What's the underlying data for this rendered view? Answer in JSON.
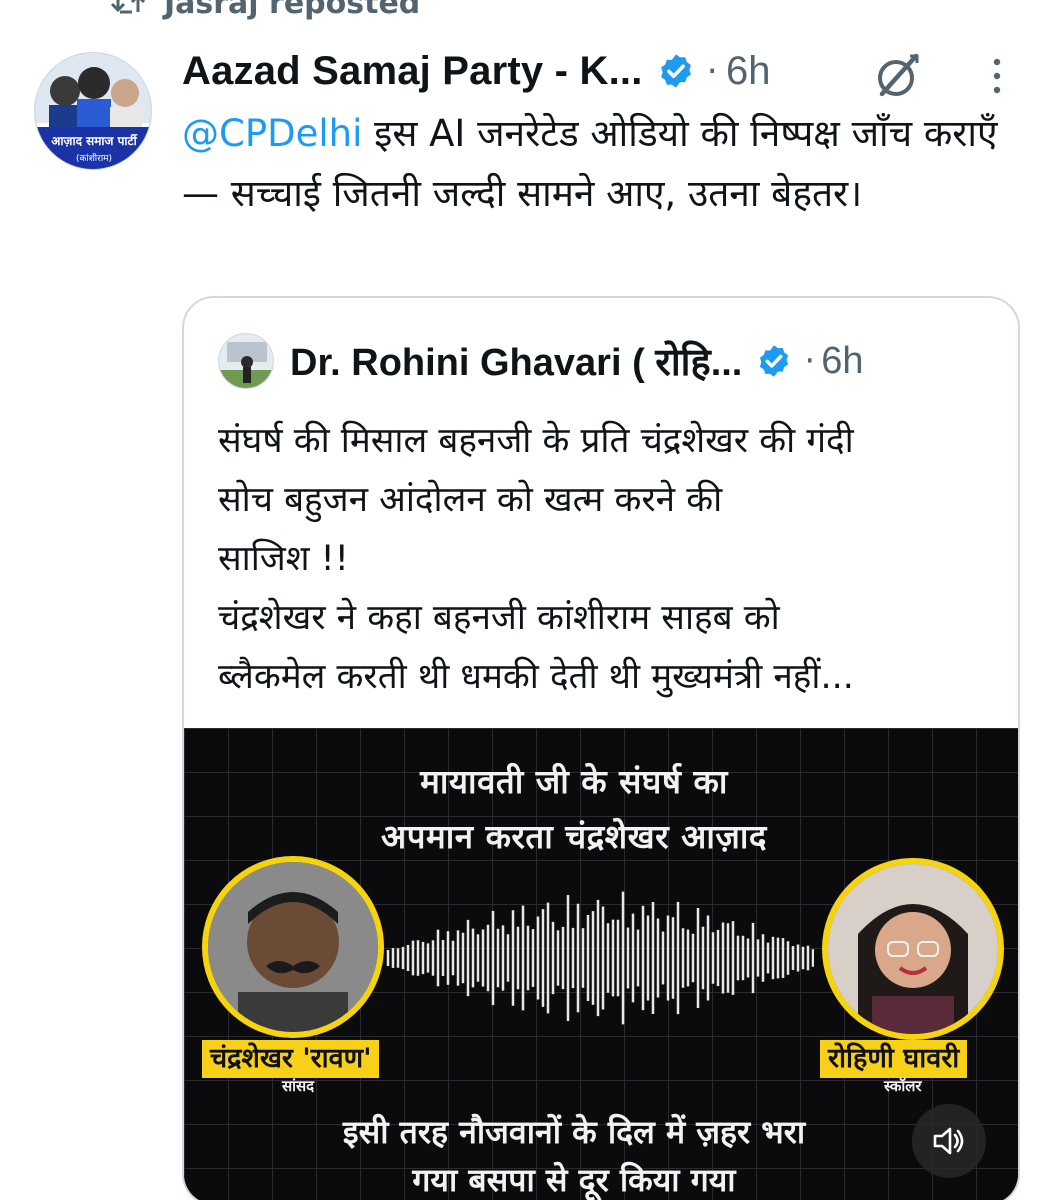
{
  "repost": {
    "text": "Jasraj reposted",
    "icon": "repost-icon"
  },
  "tweet": {
    "author": "Aazad Samaj Party - K...",
    "time": "6h",
    "mention": "@CPDelhi",
    "text": " इस AI जनरेटेड ओडियो की निष्पक्ष जाँच कराएँ — सच्चाई जितनी जल्दी सामने आए, उतना बेहतर।",
    "avatar_text_line1": "आज़ाद समाज पार्टी",
    "avatar_text_line2": "(कांशीराम)"
  },
  "quote": {
    "author": "Dr. Rohini Ghavari ( रोहि...",
    "time": "6h",
    "text": "संघर्ष की मिसाल बहनजी के प्रति चंद्रशेखर की गंदी\nसोच बहुजन आंदोलन को खत्म करने की\nसाजिश !!\nचंद्रशेखर ने कहा बहनजी कांशीराम साहब को\nब्लैकमेल करती थी धमकी देती थी मुख्यमंत्री नहीं...",
    "media": {
      "headline_1": "मायावती जी के संघर्ष का",
      "headline_2": "अपमान करता चंद्रशेखर आज़ाद",
      "left_name": "चंद्रशेखर 'रावण'",
      "left_role": "सांसद",
      "right_name": "रोहिणी घावरी",
      "right_role": "स्कॉलर",
      "footer_1": "इसी तरह नौजवानों के दिल में ज़हर भरा",
      "footer_2": "गया बसपा से दूर किया गया"
    }
  },
  "colors": {
    "accent": "#1d9bf0",
    "muted": "#536471",
    "highlight": "#f7d117"
  }
}
